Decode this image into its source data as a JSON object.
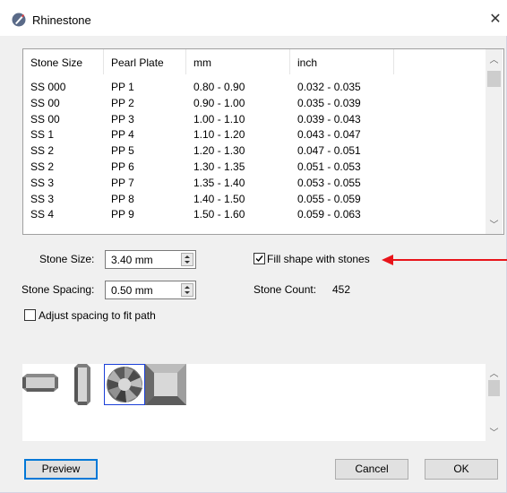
{
  "window": {
    "title": "Rhinestone",
    "close_glyph": "✕"
  },
  "table": {
    "columns": [
      "Stone Size",
      "Pearl Plate",
      "mm",
      "inch"
    ],
    "rows": [
      [
        "SS 000",
        "PP 1",
        "0.80 - 0.90",
        "0.032 - 0.035"
      ],
      [
        "SS 00",
        "PP 2",
        "0.90 - 1.00",
        "0.035 - 0.039"
      ],
      [
        "SS 00",
        "PP 3",
        "1.00 - 1.10",
        "0.039 - 0.043"
      ],
      [
        "SS 1",
        "PP 4",
        "1.10 - 1.20",
        "0.043 - 0.047"
      ],
      [
        "SS 2",
        "PP 5",
        "1.20 - 1.30",
        "0.047 - 0.051"
      ],
      [
        "SS 2",
        "PP 6",
        "1.30 - 1.35",
        "0.051 - 0.053"
      ],
      [
        "SS 3",
        "PP 7",
        "1.35 - 1.40",
        "0.053 - 0.055"
      ],
      [
        "SS 3",
        "PP 8",
        "1.40 - 1.50",
        "0.055 - 0.059"
      ],
      [
        "SS 4",
        "PP 9",
        "1.50 - 1.60",
        "0.059 - 0.063"
      ]
    ]
  },
  "controls": {
    "stone_size_label": "Stone Size:",
    "stone_size_value": "3.40 mm",
    "stone_spacing_label": "Stone Spacing:",
    "stone_spacing_value": "0.50 mm",
    "fill_shape_label": "Fill shape with stones",
    "fill_shape_checked": true,
    "stone_count_label": "Stone Count:",
    "stone_count_value": "452",
    "adjust_spacing_label": "Adjust spacing to fit path",
    "adjust_spacing_checked": false
  },
  "stone_shapes": [
    "rectangle-stone-icon",
    "baguette-stone-icon",
    "round-stone-icon",
    "square-stone-icon"
  ],
  "selected_shape": "round-stone-icon",
  "buttons": {
    "preview": "Preview",
    "cancel": "Cancel",
    "ok": "OK"
  },
  "colors": {
    "annotation_arrow": "#e8141a",
    "selection": "#1a3fd8"
  }
}
